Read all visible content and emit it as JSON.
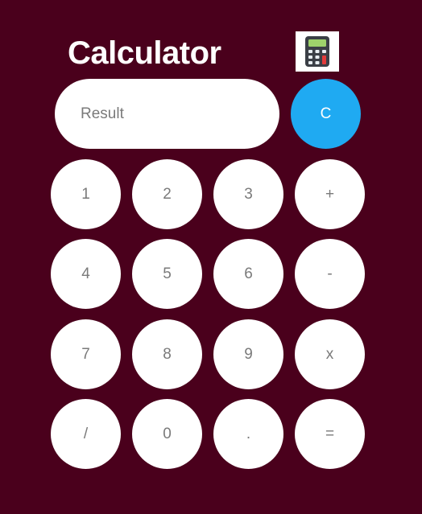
{
  "header": {
    "title": "Calculator",
    "logo_icon": "calculator-icon"
  },
  "display": {
    "placeholder": "Result",
    "value": ""
  },
  "buttons": {
    "clear": "C",
    "one": "1",
    "two": "2",
    "three": "3",
    "plus": "+",
    "four": "4",
    "five": "5",
    "six": "6",
    "minus": "-",
    "seven": "7",
    "eight": "8",
    "nine": "9",
    "multiply": "x",
    "divide": "/",
    "zero": "0",
    "dot": ".",
    "equals": "="
  },
  "colors": {
    "background": "#4a001c",
    "clear_button": "#1faaf2",
    "button_text": "#7a7a7a"
  }
}
